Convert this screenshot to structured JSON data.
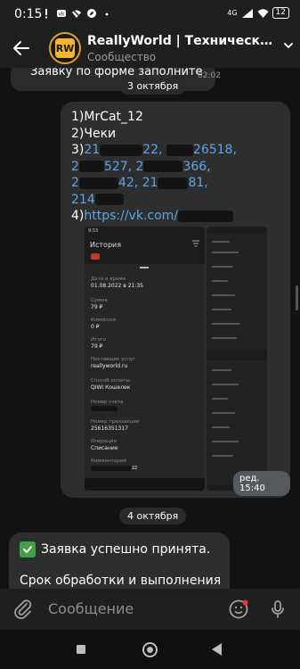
{
  "status_bar": {
    "time": "0:15",
    "network": "4G",
    "battery": "12"
  },
  "header": {
    "avatar_text": "RW",
    "title": "ReallyWorld | Техническая По...",
    "subtitle": "Сообщество"
  },
  "messages": {
    "prev": {
      "text": "Заявку по форме заполните",
      "time": "02:02"
    },
    "date_1": "3 октября",
    "main": {
      "line1": "1)MrCat_12",
      "line2": "2)Чеки",
      "line3_prefix": "3)",
      "line3_a": "21",
      "line3_b": "22,",
      "line3_c": "26518,",
      "line4_a": "2",
      "line4_b": "527,",
      "line4_c": "2",
      "line4_d": "366,",
      "line5_a": "2",
      "line5_b": "42,",
      "line5_c": "21",
      "line5_d": "81,",
      "line6_a": "214",
      "line6_b": "",
      "line7_prefix": "4)",
      "line7_link": "https://vk.com/",
      "edited_time": "ред. 15:40"
    },
    "date_2": "4 октября",
    "reply": {
      "line1": "Заявка успешно принята.",
      "line2": "Срок обработки и выполнения"
    }
  },
  "screenshot": {
    "status_time": "9:53",
    "title": "История",
    "rows": [
      {
        "label": "Дата и время",
        "value": "01.08.2022 в 21:35"
      },
      {
        "label": "Сумма",
        "value": "79 ₽"
      },
      {
        "label": "Комиссия",
        "value": "0 ₽"
      },
      {
        "label": "Итого",
        "value": "79 ₽"
      },
      {
        "label": "Поставщик услуг",
        "value": "reallyworld.ru"
      },
      {
        "label": "Способ оплаты",
        "value": "QIWI Кошелек"
      },
      {
        "label": "Номер счета",
        "value": ""
      },
      {
        "label": "Номер транзакции",
        "value": "25616351317"
      },
      {
        "label": "Операция",
        "value": "Списание"
      },
      {
        "label": "Комментарий",
        "value": "zz"
      }
    ]
  },
  "composer": {
    "placeholder": "Сообщение"
  },
  "colors": {
    "accent": "#5ea4e8",
    "bubble": "#2e2e2e",
    "check": "#43a047",
    "avatar_border": "#e0a12b"
  },
  "icons": [
    "back-arrow-icon",
    "chevron-down-icon",
    "paperclip-icon",
    "emoji-icon",
    "microphone-icon",
    "check-icon"
  ]
}
